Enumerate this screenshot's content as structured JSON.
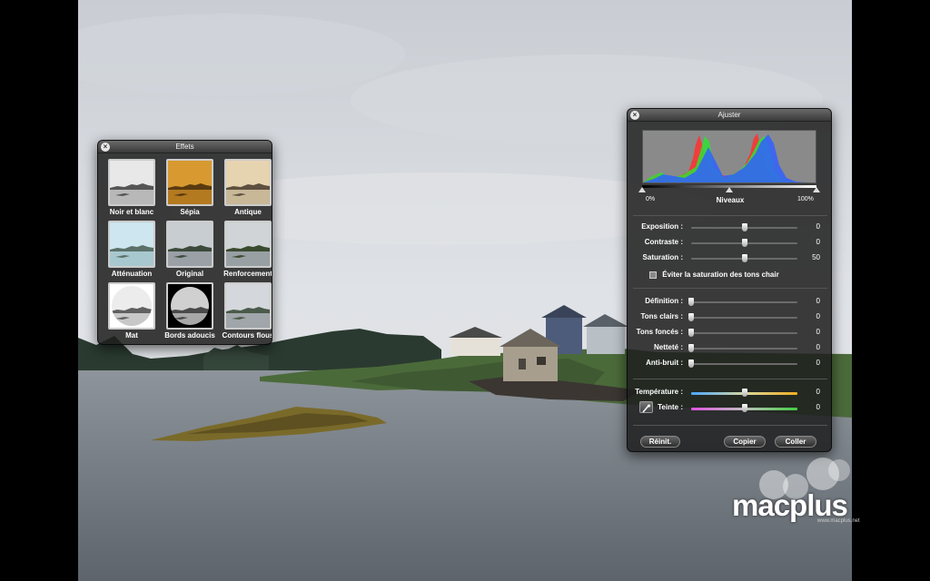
{
  "effects_window": {
    "title": "Effets",
    "effects": [
      {
        "label": "Noir et blanc",
        "style": "bw"
      },
      {
        "label": "Sépia",
        "style": "sepia"
      },
      {
        "label": "Antique",
        "style": "antique"
      },
      {
        "label": "Atténuation",
        "style": "fade"
      },
      {
        "label": "Original",
        "style": "original"
      },
      {
        "label": "Renforcement",
        "style": "boost"
      },
      {
        "label": "Mat",
        "style": "matte"
      },
      {
        "label": "Bords adoucis",
        "style": "vignette"
      },
      {
        "label": "Contours flous",
        "style": "edgeblur"
      }
    ]
  },
  "adjust_window": {
    "title": "Ajuster",
    "levels": {
      "title": "Niveaux",
      "min_label": "0%",
      "max_label": "100%",
      "black_point": 0,
      "mid_point": 0.5,
      "white_point": 1.0
    },
    "group1": [
      {
        "label": "Exposition :",
        "value": "0",
        "knob": 0.5
      },
      {
        "label": "Contraste :",
        "value": "0",
        "knob": 0.5
      },
      {
        "label": "Saturation :",
        "value": "50",
        "knob": 0.5
      }
    ],
    "skin_tone_label": "Éviter la saturation des tons chair",
    "group2": [
      {
        "label": "Définition :",
        "value": "0",
        "knob": 0.0
      },
      {
        "label": "Tons clairs :",
        "value": "0",
        "knob": 0.0
      },
      {
        "label": "Tons foncés :",
        "value": "0",
        "knob": 0.0
      },
      {
        "label": "Netteté :",
        "value": "0",
        "knob": 0.0
      },
      {
        "label": "Anti-bruit :",
        "value": "0",
        "knob": 0.0
      }
    ],
    "group3": [
      {
        "label": "Température :",
        "value": "0",
        "knob": 0.5
      },
      {
        "label": "Teinte :",
        "value": "0",
        "knob": 0.5
      }
    ],
    "buttons": {
      "reset": "Réinit.",
      "copy": "Copier",
      "paste": "Coller"
    }
  },
  "watermark": {
    "logo_text": "macplus",
    "url": "www.macplus.net"
  }
}
